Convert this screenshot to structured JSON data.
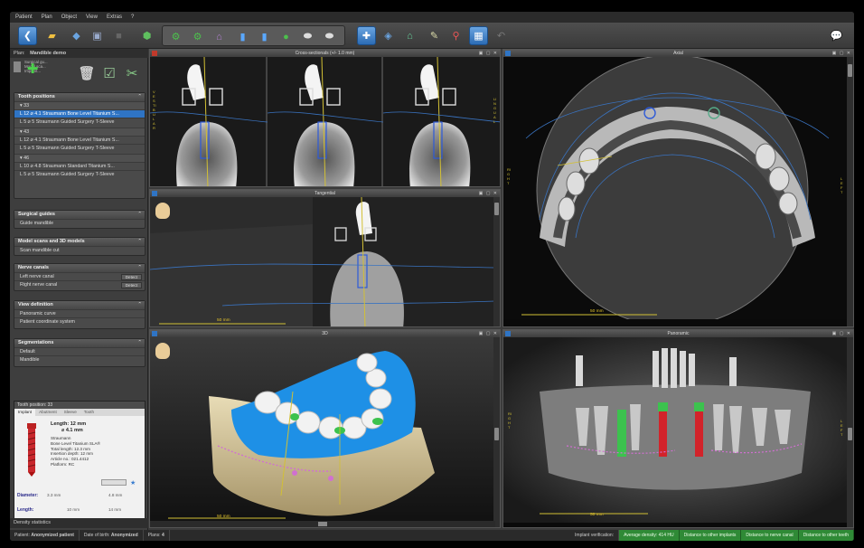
{
  "menu": [
    "Patient",
    "Plan",
    "Object",
    "View",
    "Extras",
    "?"
  ],
  "plan": {
    "header": "Plan:",
    "name": "Mandible demo",
    "subitems": [
      "Surgical gu...",
      "Model sca...",
      "Implant..."
    ]
  },
  "sections": {
    "tooth_positions": {
      "title": "Tooth positions",
      "teeth": [
        {
          "num": "33",
          "implant": "L 12  ⌀ 4.1  Straumann Bone Level Titanium S...",
          "sleeve": "L 5  ⌀ 5   Straumann Guided Surgery T-Sleeve"
        },
        {
          "num": "43",
          "implant": "L 12  ⌀ 4.1  Straumann Bone Level Titanium S...",
          "sleeve": "L 5  ⌀ 5   Straumann Guided Surgery T-Sleeve"
        },
        {
          "num": "46",
          "implant": "L 10  ⌀ 4.8  Straumann Standard Titanium S...",
          "sleeve": "L 5  ⌀ 5   Straumann Guided Surgery T-Sleeve"
        }
      ]
    },
    "surgical_guides": {
      "title": "Surgical guides",
      "items": [
        "Guide mandible"
      ]
    },
    "model_scans": {
      "title": "Model scans and 3D models",
      "items": [
        "Scan mandible cut"
      ]
    },
    "nerve_canals": {
      "title": "Nerve canals",
      "items": [
        {
          "label": "Left nerve canal",
          "button": "Detect"
        },
        {
          "label": "Right nerve canal",
          "button": "Detect"
        }
      ]
    },
    "view_definition": {
      "title": "View definition",
      "items": [
        "Panoramic curve",
        "Patient coordinate system"
      ]
    },
    "segmentations": {
      "title": "Segmentations",
      "items": [
        "Default",
        "Mandible"
      ]
    }
  },
  "tooth_position_panel": {
    "header": "Tooth position: 33",
    "tabs": [
      "Implant",
      "Abutment",
      "Sleeve",
      "Tooth"
    ],
    "length_label": "Length: 12 mm",
    "diameter_value": "⌀ 4.1 mm",
    "details": [
      "Straumann",
      "Bone Level Titanium SLA®",
      "Total length: 12.3 mm",
      "Insertion depth: 12 mm",
      "Article no.: 021.4412",
      "Platform: RC"
    ],
    "diameter": {
      "label": "Diameter:",
      "low": "3.3 mm",
      "high": "4.8 mm"
    },
    "length": {
      "label": "Length:",
      "low": "10 mm",
      "high": "14 mm"
    }
  },
  "density_statistics": "Density statistics",
  "views": {
    "cross": {
      "title": "Cross-sectionals (+/- 1.0 mm)",
      "side_left": "VESTIBULAR",
      "side_right": "LINGUAL"
    },
    "axial": {
      "title": "Axial",
      "scale": "50 mm",
      "side_left": "RIGHT",
      "side_right": "LEFT"
    },
    "tangential": {
      "title": "Tangential",
      "scale": "50 mm"
    },
    "view3d": {
      "title": "3D",
      "scale": "50 mm"
    },
    "panoramic": {
      "title": "Panoramic",
      "scale": "50 mm",
      "side_left": "RIGHT",
      "side_right": "LEFT"
    }
  },
  "status": {
    "patient_label": "Patient:",
    "patient_value": "Anonymized patient",
    "dob_label": "Date of birth:",
    "dob_value": "Anonymized",
    "plans_label": "Plans:",
    "plans_value": "4",
    "implant_verification": "Implant verification:",
    "avg_density": "Average density: 414 HU",
    "dist_implants": "Distance to other implants",
    "dist_canal": "Distance to nerve canal",
    "dist_teeth": "Distance to other teeth"
  },
  "colors": {
    "accent": "#2f74c4",
    "implant_green": "#3cc24e",
    "guide_blue": "#1e90e6",
    "sleeve_red": "#d2232a",
    "scale_yellow": "#e2c22a"
  },
  "icons": [
    "back-icon",
    "open-folder-icon",
    "synchronize-icon",
    "dental-chair-icon",
    "stop-icon",
    "cube-icon",
    "implant-tool-icons",
    "measure-icon",
    "snapshot-icon",
    "help-icon"
  ]
}
